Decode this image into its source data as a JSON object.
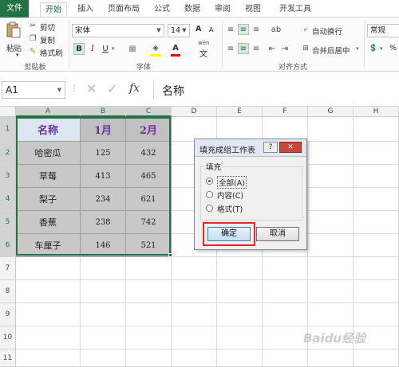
{
  "ribbon": {
    "tabs": [
      "文件",
      "开始",
      "插入",
      "页面布局",
      "公式",
      "数据",
      "审阅",
      "视图",
      "开发工具"
    ],
    "clipboard": {
      "paste": "粘贴",
      "cut": "剪切",
      "copy": "复制",
      "format_painter": "格式刷",
      "group": "剪贴板"
    },
    "font": {
      "name": "宋体",
      "size": "14",
      "bold": "B",
      "italic": "I",
      "underline": "U",
      "group": "字体",
      "grow": "A",
      "shrink": "A",
      "wen": "wén",
      "wen_char": "文",
      "font_color": "A"
    },
    "alignment": {
      "wrap": "自动换行",
      "merge": "合并后居中",
      "group": "对齐方式"
    },
    "number": {
      "format": "常规",
      "percent": "%"
    }
  },
  "formula_bar": {
    "name_box": "A1",
    "fx": "fx",
    "value": "名称"
  },
  "grid": {
    "columns": [
      "A",
      "B",
      "C",
      "D",
      "E",
      "F",
      "G",
      "H"
    ],
    "rows": [
      "1",
      "2",
      "3",
      "4",
      "5",
      "6",
      "7",
      "8",
      "9",
      "10",
      "11"
    ],
    "header": [
      "名称",
      "1月",
      "2月"
    ],
    "data": [
      [
        "哈密瓜",
        "125",
        "432"
      ],
      [
        "草莓",
        "413",
        "465"
      ],
      [
        "梨子",
        "234",
        "621"
      ],
      [
        "香蕉",
        "238",
        "742"
      ],
      [
        "车厘子",
        "146",
        "521"
      ]
    ]
  },
  "dialog": {
    "title": "填充成组工作表",
    "help": "?",
    "close": "✕",
    "group_label": "填充",
    "options": [
      "全部(A)",
      "内容(C)",
      "格式(T)"
    ],
    "selected": 0,
    "ok": "确定",
    "cancel": "取消"
  },
  "watermark": "Baidu经验",
  "colors": {
    "accent": "#217346",
    "header_text": "#7030a0",
    "header_fill": "#dce6f1",
    "data_fill": "#c8c8c8",
    "highlight": "#e8262a"
  }
}
